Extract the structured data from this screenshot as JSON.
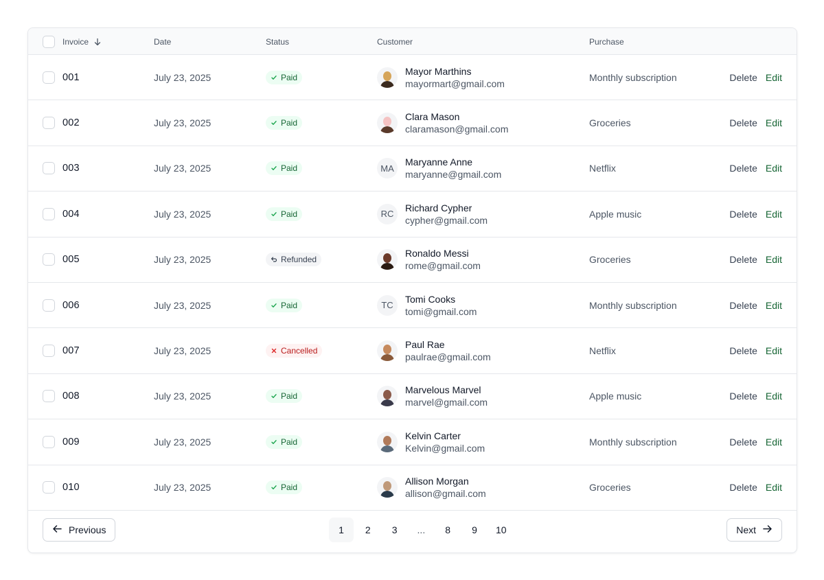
{
  "table": {
    "columns": {
      "invoice": "Invoice",
      "date": "Date",
      "status": "Status",
      "customer": "Customer",
      "purchase": "Purchase"
    },
    "sort_icon": "arrow-down-icon",
    "rows": [
      {
        "invoice": "001",
        "date": "July 23, 2025",
        "status": "Paid",
        "status_type": "paid",
        "name": "Mayor Marthins",
        "email": "mayormart@gmail.com",
        "avatar": "photo",
        "purchase": "Monthly subscription"
      },
      {
        "invoice": "002",
        "date": "July 23, 2025",
        "status": "Paid",
        "status_type": "paid",
        "name": "Clara Mason",
        "email": "claramason@gmail.com",
        "avatar": "photo",
        "purchase": "Groceries"
      },
      {
        "invoice": "003",
        "date": "July 23, 2025",
        "status": "Paid",
        "status_type": "paid",
        "name": "Maryanne Anne",
        "email": "maryanne@gmail.com",
        "avatar": "MA",
        "purchase": "Netflix"
      },
      {
        "invoice": "004",
        "date": "July 23, 2025",
        "status": "Paid",
        "status_type": "paid",
        "name": "Richard Cypher",
        "email": "cypher@gmail.com",
        "avatar": "RC",
        "purchase": "Apple music"
      },
      {
        "invoice": "005",
        "date": "July 23, 2025",
        "status": "Refunded",
        "status_type": "refunded",
        "name": "Ronaldo Messi",
        "email": "rome@gmail.com",
        "avatar": "photo",
        "purchase": "Groceries"
      },
      {
        "invoice": "006",
        "date": "July 23, 2025",
        "status": "Paid",
        "status_type": "paid",
        "name": "Tomi Cooks",
        "email": "tomi@gmail.com",
        "avatar": "TC",
        "purchase": "Monthly subscription"
      },
      {
        "invoice": "007",
        "date": "July 23, 2025",
        "status": "Cancelled",
        "status_type": "cancelled",
        "name": "Paul Rae",
        "email": "paulrae@gmail.com",
        "avatar": "photo",
        "purchase": "Netflix"
      },
      {
        "invoice": "008",
        "date": "July 23, 2025",
        "status": "Paid",
        "status_type": "paid",
        "name": "Marvelous  Marvel",
        "email": "marvel@gmail.com",
        "avatar": "photo",
        "purchase": "Apple music"
      },
      {
        "invoice": "009",
        "date": "July 23, 2025",
        "status": "Paid",
        "status_type": "paid",
        "name": "Kelvin Carter",
        "email": "Kelvin@gmail.com",
        "avatar": "photo",
        "purchase": "Monthly subscription"
      },
      {
        "invoice": "010",
        "date": "July 23, 2025",
        "status": "Paid",
        "status_type": "paid",
        "name": "Allison Morgan",
        "email": "allison@gmail.com",
        "avatar": "photo",
        "purchase": "Groceries"
      }
    ],
    "actions": {
      "delete": "Delete",
      "edit": "Edit"
    }
  },
  "pagination": {
    "previous": "Previous",
    "next": "Next",
    "pages": [
      "1",
      "2",
      "3",
      "...",
      "8",
      "9",
      "10"
    ],
    "current": "1"
  },
  "colors": {
    "paid_bg": "#ecfdf3",
    "paid_text": "#166534",
    "cancelled_bg": "#fef2f2",
    "cancelled_text": "#b91c1c",
    "refunded_bg": "#f3f4f6",
    "edit_link": "#166534"
  }
}
